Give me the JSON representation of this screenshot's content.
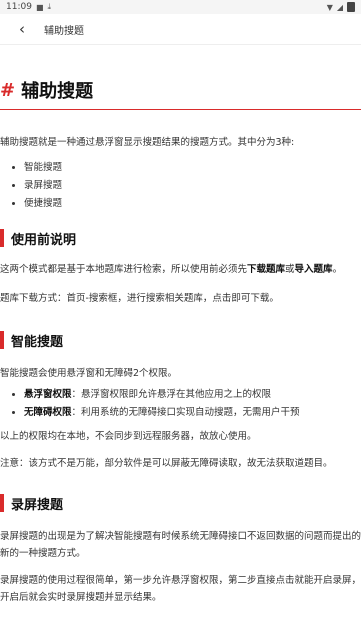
{
  "status": {
    "time": "11:09"
  },
  "topbar": {
    "title": "辅助搜题"
  },
  "article": {
    "title_hash": "#",
    "title": "辅助搜题",
    "intro": "辅助搜题就是一种通过悬浮窗显示搜题结果的搜题方式。其中分为3种:",
    "modes": [
      "智能搜题",
      "录屏搜题",
      "便捷搜题"
    ],
    "sec1": {
      "heading": "使用前说明",
      "p1_a": "这两个模式都是基于本地题库进行检索，所以使用前必须先",
      "p1_b": "下载题库",
      "p1_c": "或",
      "p1_d": "导入题库",
      "p1_e": "。",
      "p2": "题库下载方式：首页-搜索框，进行搜索相关题库，点击即可下载。"
    },
    "sec2": {
      "heading": "智能搜题",
      "p1": "智能搜题会使用悬浮窗和无障碍2个权限。",
      "items": [
        {
          "label": "悬浮窗权限",
          "text": "：悬浮窗权限即允许悬浮在其他应用之上的权限"
        },
        {
          "label": "无障碍权限",
          "text": "：利用系统的无障碍接口实现自动搜题，无需用户干预"
        }
      ],
      "p2": "以上的权限均在本地，不会同步到远程服务器，故放心使用。",
      "p3": "注意：该方式不是万能，部分软件是可以屏蔽无障碍读取，故无法获取道题目。"
    },
    "sec3": {
      "heading": "录屏搜题",
      "p1": "录屏搜题的出现是为了解决智能搜题有时候系统无障碍接口不返回数据的问题而提出的新的一种搜题方式。",
      "p2": "录屏搜题的使用过程很简单，第一步允许悬浮窗权限，第二步直接点击就能开启录屏，开启后就会实时录屏搜题并显示结果。"
    }
  }
}
